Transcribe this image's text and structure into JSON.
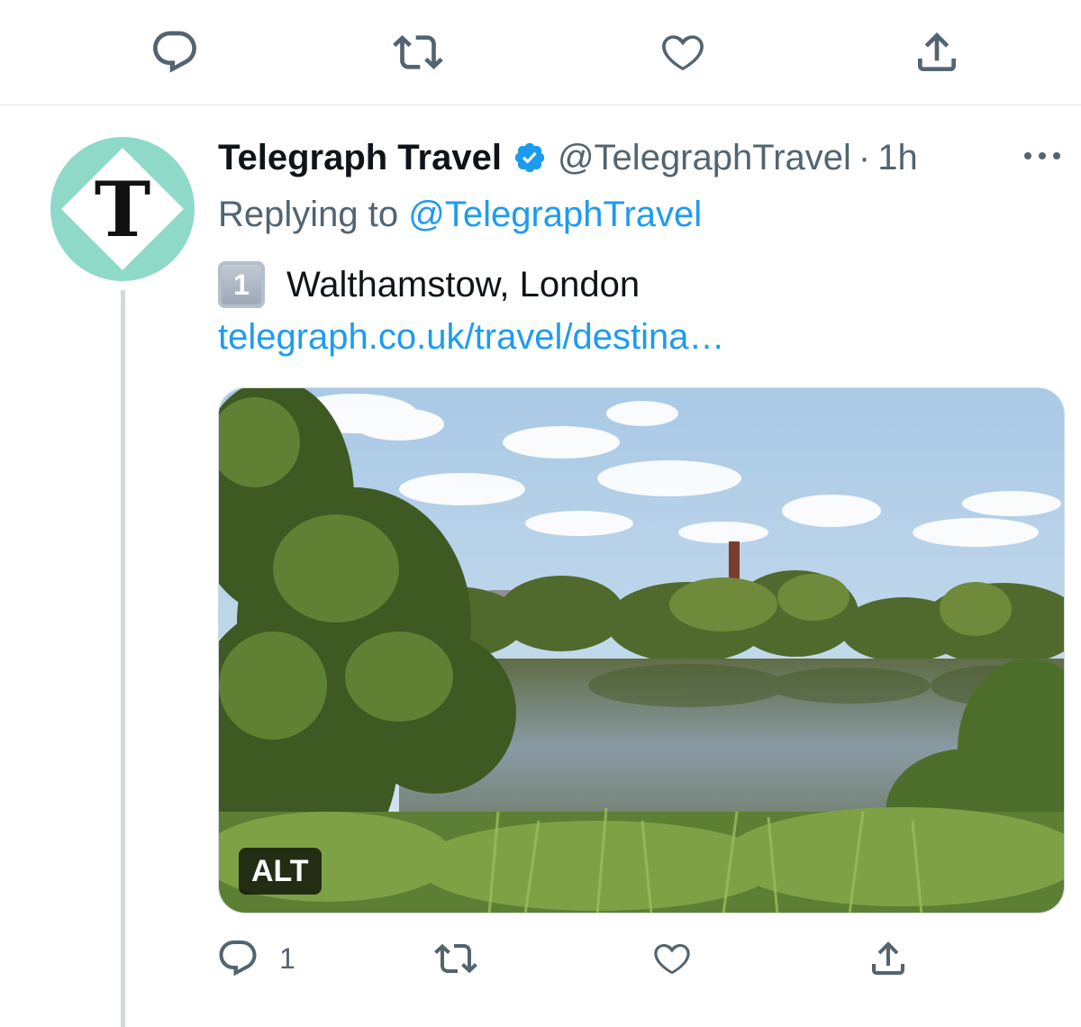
{
  "top_actions": {
    "reply_icon": "reply-icon",
    "retweet_icon": "retweet-icon",
    "like_icon": "heart-icon",
    "share_icon": "share-icon"
  },
  "tweet": {
    "author": {
      "name": "Telegraph Travel",
      "handle": "@TelegraphTravel",
      "verified": true,
      "avatar_letter": "T",
      "avatar_color": "#8fd9c8"
    },
    "separator": "·",
    "time": "1h",
    "replying_prefix": "Replying to",
    "replying_to": "@TelegraphTravel",
    "keycap": "1",
    "text": "Walthamstow, London",
    "link": "telegraph.co.uk/travel/destina…",
    "media": {
      "alt_badge": "ALT"
    },
    "actions": {
      "reply_count": "1"
    }
  },
  "colors": {
    "accent": "#1d9bf0",
    "secondary_text": "#536471",
    "icon": "#536471"
  }
}
